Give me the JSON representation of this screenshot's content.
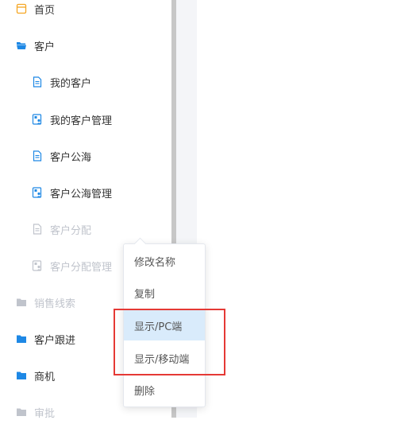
{
  "sidebar": {
    "items": [
      {
        "label": "首页",
        "icon": "home-icon"
      },
      {
        "label": "客户",
        "icon": "folder-open-icon"
      },
      {
        "label": "我的客户",
        "icon": "document-icon"
      },
      {
        "label": "我的客户管理",
        "icon": "user-document-icon"
      },
      {
        "label": "客户公海",
        "icon": "document-icon"
      },
      {
        "label": "客户公海管理",
        "icon": "user-document-icon"
      },
      {
        "label": "客户分配",
        "icon": "document-icon"
      },
      {
        "label": "客户分配管理",
        "icon": "user-document-icon"
      },
      {
        "label": "销售线索",
        "icon": "folder-icon"
      },
      {
        "label": "客户跟进",
        "icon": "folder-icon"
      },
      {
        "label": "商机",
        "icon": "folder-icon"
      },
      {
        "label": "审批",
        "icon": "folder-icon"
      }
    ]
  },
  "context_menu": {
    "items": [
      {
        "label": "修改名称"
      },
      {
        "label": "复制"
      },
      {
        "label": "显示/PC端"
      },
      {
        "label": "显示/移动端"
      },
      {
        "label": "删除"
      }
    ]
  },
  "colors": {
    "accent": "#1e88e5",
    "home_icon": "#f5a623",
    "disabled": "#c0c4cc",
    "highlight": "#e53935",
    "active_menu_bg": "#d9ebfb"
  }
}
